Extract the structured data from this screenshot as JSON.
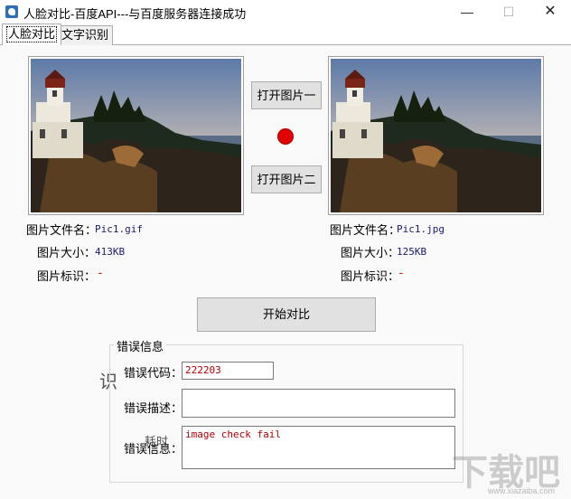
{
  "window": {
    "title": "人脸对比-百度API---与百度服务器连接成功",
    "minimize_glyph": "—",
    "maximize_glyph": "☐",
    "close_glyph": "✕"
  },
  "tabs": [
    {
      "label": "人脸对比",
      "active": true
    },
    {
      "label": "文字识别",
      "active": false
    }
  ],
  "buttons": {
    "open_first": "打开图片一",
    "open_second": "打开图片二",
    "compare": "开始对比"
  },
  "status_indicator": {
    "color": "#e00000"
  },
  "image1": {
    "filename_label": "图片文件名：",
    "filename": "Pic1.gif",
    "size_label": "图片大小：",
    "size": "413KB",
    "tag_label": "图片标识：",
    "tag": "-"
  },
  "image2": {
    "filename_label": "图片文件名：",
    "filename": "Pic1.jpg",
    "size_label": "图片大小：",
    "size": "125KB",
    "tag_label": "图片标识：",
    "tag": "-"
  },
  "error_group": {
    "title": "错误信息",
    "code_label": "错误代码：",
    "code": "222203",
    "desc_label": "错误描述：",
    "desc": "",
    "msg_label": "错误信息：",
    "msg": "image check fail"
  },
  "background_text": {
    "partial_char": "识",
    "time_label": "耗时"
  },
  "watermark": {
    "text": "下载吧",
    "subtext": "www.xiazaiba.com"
  }
}
